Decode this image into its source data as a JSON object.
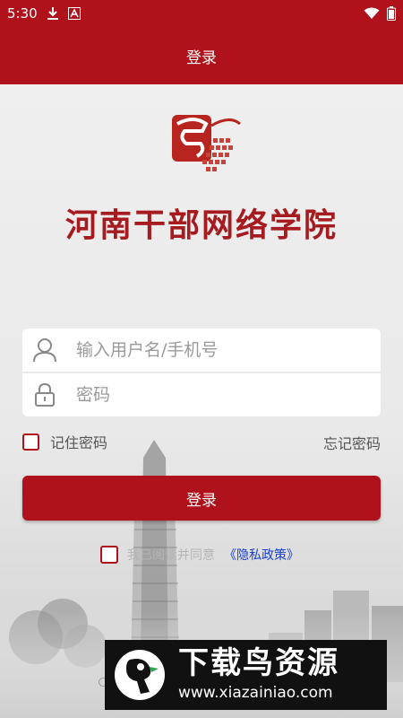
{
  "status_bar": {
    "time": "5:30",
    "icons": [
      "download-icon",
      "a-icon",
      "wifi-icon",
      "battery-icon"
    ]
  },
  "app_bar": {
    "title": "登录"
  },
  "brand": {
    "logo_icon": "school-logo-icon",
    "name": "河南干部网络学院",
    "name_color": "#a51b1f"
  },
  "form": {
    "username": {
      "value": "",
      "placeholder": "输入用户名/手机号",
      "icon": "user-icon"
    },
    "password": {
      "value": "",
      "placeholder": "密码",
      "icon": "lock-icon"
    },
    "remember_label": "记住密码",
    "forgot_label": "忘记密码",
    "login_label": "登录"
  },
  "privacy": {
    "text": "我已阅读并同意",
    "link_label": "《隐私政策》"
  },
  "watermark": {
    "title": "下载鸟资源",
    "url": "www.xiazainiao.com"
  },
  "colors": {
    "primary": "#b0121b",
    "link": "#1a3fd1"
  }
}
